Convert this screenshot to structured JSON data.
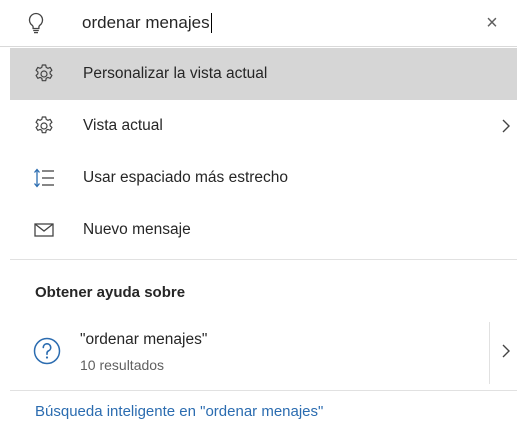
{
  "search": {
    "query": "ordenar menajes",
    "icon": "lightbulb-icon",
    "clear_icon": "close-icon",
    "clear_glyph": "×"
  },
  "actions": [
    {
      "label": "Personalizar la vista actual",
      "icon": "gear-icon",
      "selected": true
    },
    {
      "label": "Vista actual",
      "icon": "gear-icon",
      "has_submenu": true
    },
    {
      "label": "Usar espaciado más estrecho",
      "icon": "line-spacing-icon"
    },
    {
      "label": "Nuevo mensaje",
      "icon": "envelope-icon"
    }
  ],
  "help": {
    "title": "Obtener ayuda sobre",
    "query": "\"ordenar menajes\"",
    "results": "10 resultados",
    "icon": "question-circle-icon"
  },
  "smart_search_link": "Búsqueda inteligente en \"ordenar menajes\"",
  "colors": {
    "selected_bg": "#d6d6d6",
    "link": "#2b6cb0",
    "icon_blue": "#2b6cb0"
  }
}
